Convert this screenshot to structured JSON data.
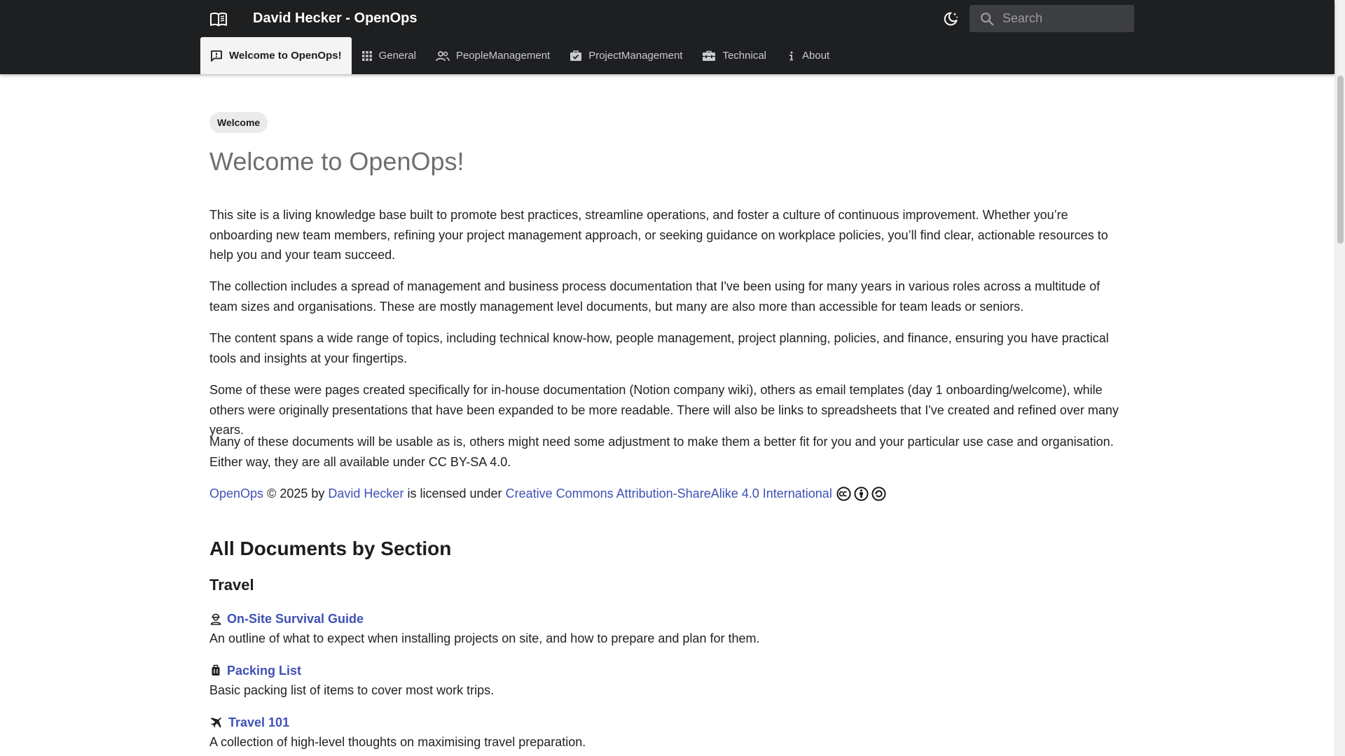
{
  "header": {
    "site_title": "David Hecker - OpenOps",
    "search_placeholder": "Search",
    "logo_icon": "book-open-icon",
    "theme_icon": "dark-mode-moon-icon"
  },
  "tabs": [
    {
      "label": "Welcome to OpenOps!",
      "icon": "comment-icon",
      "active": true
    },
    {
      "label": "General",
      "icon": "apps-grid-icon",
      "active": false
    },
    {
      "label": "PeopleManagement",
      "icon": "people-icon",
      "active": false
    },
    {
      "label": "ProjectManagement",
      "icon": "briefcase-check-icon",
      "active": false
    },
    {
      "label": "Technical",
      "icon": "toolbox-icon",
      "active": false
    },
    {
      "label": "About",
      "icon": "info-icon",
      "active": false
    }
  ],
  "main": {
    "breadcrumb": "Welcome",
    "title": "Welcome to OpenOps!",
    "paragraphs": [
      "This site is a living knowledge base built to promote best practices, streamline operations, and foster a culture of continuous improvement. Whether you’re onboarding new team members, refining your project management approach, or seeking guidance on workplace policies, you’ll find clear, actionable resources to help you and your team succeed.",
      "The collection includes a spread of management and business process documentation that I've been using for many years in various roles across a multitude of team sizes and organisations. These are mostly management level documents, but many are also more than accessible for team leads or seniors.",
      "The content spans a wide range of topics, including technical know-how, people management, project planning, policies, and finance, ensuring you have practical tools and insights at your fingertips.",
      "Some of these were pages created specifically for in-house documentation (Notion company wiki), others as email templates (day 1 onboarding/welcome), while others were originally presentations that have been expanded to be more readable. There will also be links to spreadsheets that I've created and refined over many years.",
      "Many of these documents will be usable as is, others might need some adjustment to make them a better fit for you and your particular use case and organisation. Either way, they are all available under CC BY-SA 4.0."
    ],
    "license": {
      "site_link": "OpenOps",
      "copyright": "© 2025 by",
      "author_link": "David Hecker",
      "licensed_text": "is licensed under",
      "license_link": "Creative Commons Attribution-ShareAlike 4.0 International",
      "icons": [
        "cc-icon",
        "by-icon",
        "sa-icon"
      ]
    },
    "section_heading": "All Documents by Section",
    "sections": [
      {
        "title": "Travel",
        "docs": [
          {
            "title": "On-Site Survival Guide",
            "desc": "An outline of what to expect when installing projects on site, and how to prepare and plan for them.",
            "icon": "worker-icon"
          },
          {
            "title": "Packing List",
            "desc": "Basic packing list of items to cover most work trips.",
            "icon": "luggage-icon"
          },
          {
            "title": "Travel 101",
            "desc": "A collection of high-level thoughts on maximising travel preparation.",
            "icon": "flight-icon"
          }
        ]
      }
    ]
  }
}
